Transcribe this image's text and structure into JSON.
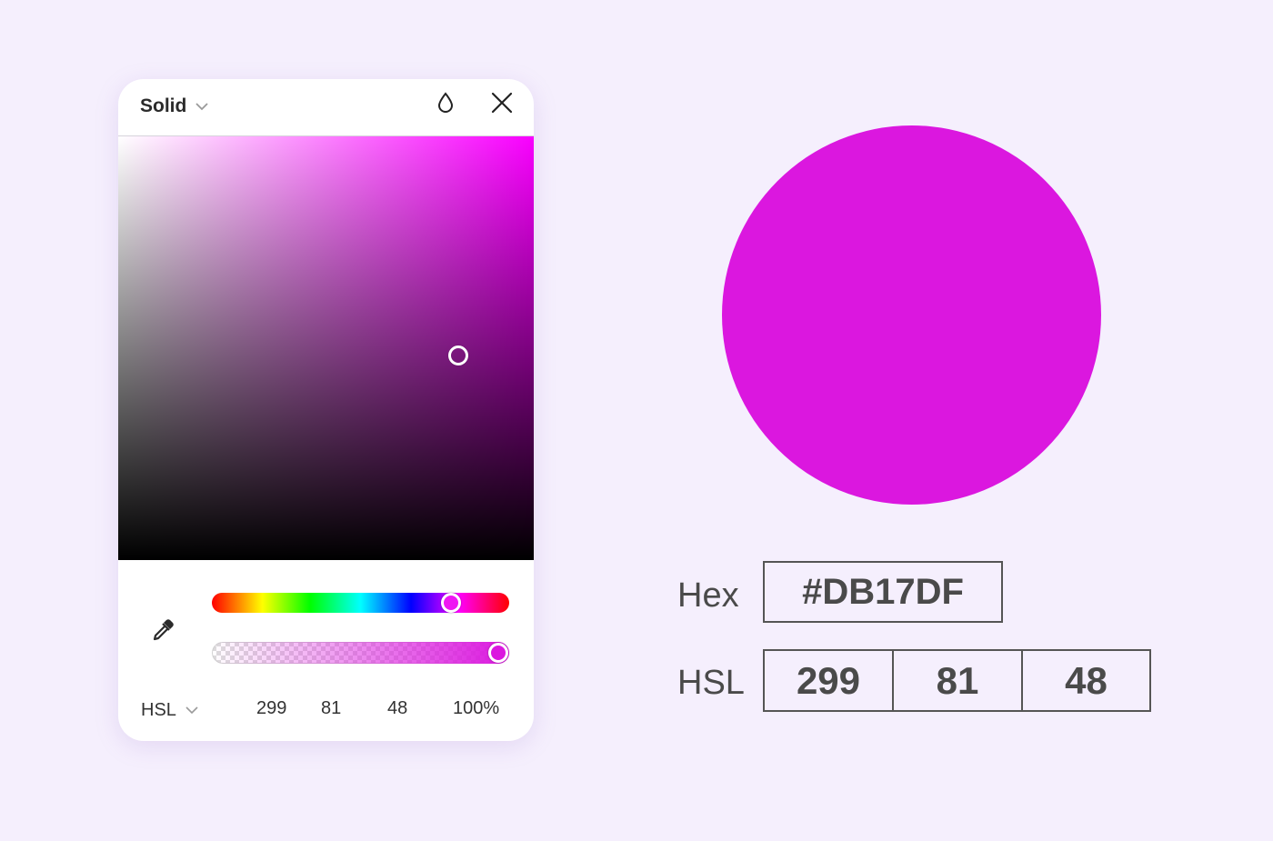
{
  "picker": {
    "mode": "Solid",
    "icons": {
      "mode_chevron": "chevron-down-icon",
      "opacity": "droplet-icon",
      "close": "close-icon",
      "eyedropper": "eyedropper-icon",
      "format_chevron": "chevron-down-icon"
    },
    "format": "HSL",
    "values": {
      "h": "299",
      "s": "81",
      "l": "48",
      "alpha": "100%"
    },
    "hue_degrees": 299,
    "alpha_fraction": 1.0,
    "saturation": 81,
    "lightness": 48
  },
  "preview": {
    "color": "#DB17DF",
    "hex_label": "Hex",
    "hex_value": "#DB17DF",
    "hsl_label": "HSL",
    "hsl_values": [
      "299",
      "81",
      "48"
    ]
  },
  "colors": {
    "background": "#F5EFFD",
    "panel": "#FFFFFF",
    "selected": "#DB17DF",
    "text": "#4A4A4A"
  }
}
